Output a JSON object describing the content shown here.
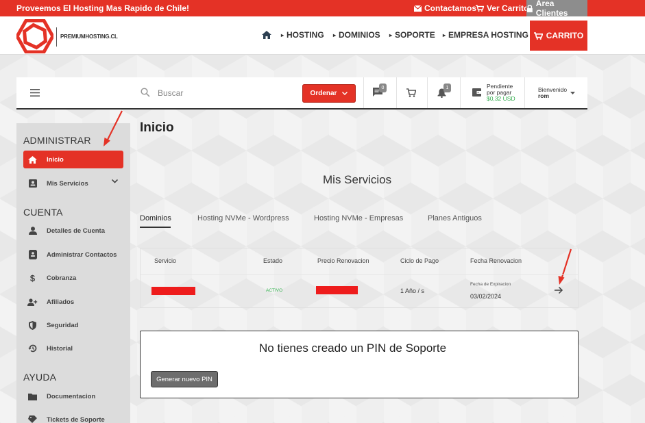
{
  "topbar": {
    "promo": "Proveemos El Hosting Mas Rapido de Chile!",
    "contact": "Contactamos",
    "cart": "Ver Carrito",
    "area": "Area Clientes"
  },
  "header": {
    "logo_text": "PREMIUMHOSTING.CL",
    "nav": [
      "HOSTING",
      "DOMINIOS",
      "SOPORTE",
      "EMPRESA HOSTING"
    ],
    "cart_button": "CARRITO"
  },
  "appbar": {
    "search_placeholder": "Buscar",
    "order_button": "Ordenar",
    "messages_count": "0",
    "notifications_count": "1",
    "pending_line1": "Pendiente",
    "pending_line2": "por pagar",
    "pending_amount": "$0,32 USD",
    "welcome": "Bienvenido",
    "username": "rom"
  },
  "sidebar": {
    "sections": [
      {
        "title": "ADMINISTRAR"
      },
      {
        "title": "CUENTA"
      },
      {
        "title": "AYUDA"
      }
    ],
    "items": [
      {
        "label": "Inicio",
        "icon": "home-icon"
      },
      {
        "label": "Mis Servicios",
        "icon": "services-icon"
      },
      {
        "label": "Detalles de Cuenta",
        "icon": "person-icon"
      },
      {
        "label": "Administrar Contactos",
        "icon": "contacts-icon"
      },
      {
        "label": "Cobranza",
        "icon": "dollar-icon"
      },
      {
        "label": "Afiliados",
        "icon": "affiliates-icon"
      },
      {
        "label": "Seguridad",
        "icon": "shield-icon"
      },
      {
        "label": "Historial",
        "icon": "history-icon"
      },
      {
        "label": "Documentacion",
        "icon": "folder-icon"
      },
      {
        "label": "Tickets de Soporte",
        "icon": "ticket-icon"
      }
    ]
  },
  "main": {
    "title": "Inicio",
    "services_title": "Mis Servicios",
    "tabs": [
      "Dominios",
      "Hosting NVMe - Wordpress",
      "Hosting NVMe - Empresas",
      "Planes Antiguos"
    ],
    "table": {
      "headers": [
        "Servicio",
        "Estado",
        "Precio Renovacion",
        "Ciclo de Pago",
        "Fecha Renovacion"
      ],
      "row": {
        "status": "ACTIVO",
        "cycle": "1 Año / s",
        "expiry_label": "Fecha de Expiracion",
        "expiry_date": "03/02/2024"
      }
    },
    "pin_title": "No tienes creado un PIN de Soporte",
    "pin_button": "Generar nuevo PIN"
  },
  "colors": {
    "brand_red": "#e43226",
    "active_green": "#32b14d",
    "pending_green": "#2eaa4a"
  }
}
